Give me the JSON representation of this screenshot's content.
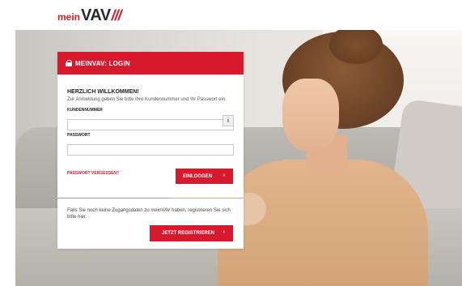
{
  "brand": {
    "mein": "mein",
    "vav": "VAV",
    "slashes": "///"
  },
  "login": {
    "title": "MEINVAV: LOGIN",
    "welcome_title": "HERZLICH WILLKOMMEN!",
    "welcome_text": "Zur Anmeldung geben Sie bitte Ihre Kundennummer und Ihr Passwort ein.",
    "customer_label": "KUNDENNUMMER",
    "customer_value": "",
    "info_symbol": "i",
    "password_label": "PASSWORT",
    "password_value": "",
    "forgot_label": "PASSWORT VERGESSEN?",
    "login_button": "EINLOGGEN",
    "chevron": "›"
  },
  "register": {
    "text": "Falls Sie noch keine Zugangsdaten zu meinVAV haben, registrieren Sie sich bitte hier.",
    "button": "JETZT REGISTRIEREN",
    "chevron": "›"
  },
  "colors": {
    "brand_red": "#d6192c",
    "text_dark": "#222222"
  }
}
